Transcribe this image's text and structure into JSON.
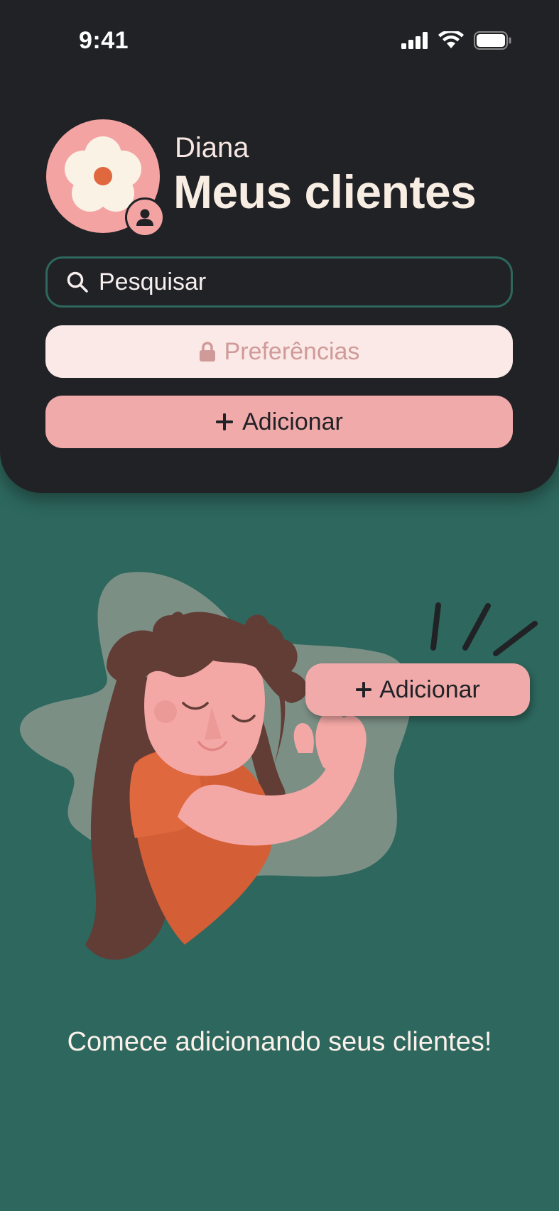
{
  "status_bar": {
    "time": "9:41"
  },
  "header": {
    "user_name": "Diana",
    "title": "Meus clientes"
  },
  "search": {
    "label": "Pesquisar",
    "icon": "search-icon"
  },
  "buttons": {
    "preferences_label": "Preferências",
    "preferences_icon": "lock-icon",
    "add_label": "Adicionar",
    "add_icon": "plus-icon"
  },
  "illustration": {
    "button_label": "Adicionar"
  },
  "empty_state": {
    "message": "Comece adicionando seus clientes!"
  },
  "colors": {
    "header_bg": "#212226",
    "page_bg": "#2d675d",
    "accent_pink": "#f1aaaa",
    "light_pink": "#fbe9e7",
    "orange": "#e0683f"
  }
}
